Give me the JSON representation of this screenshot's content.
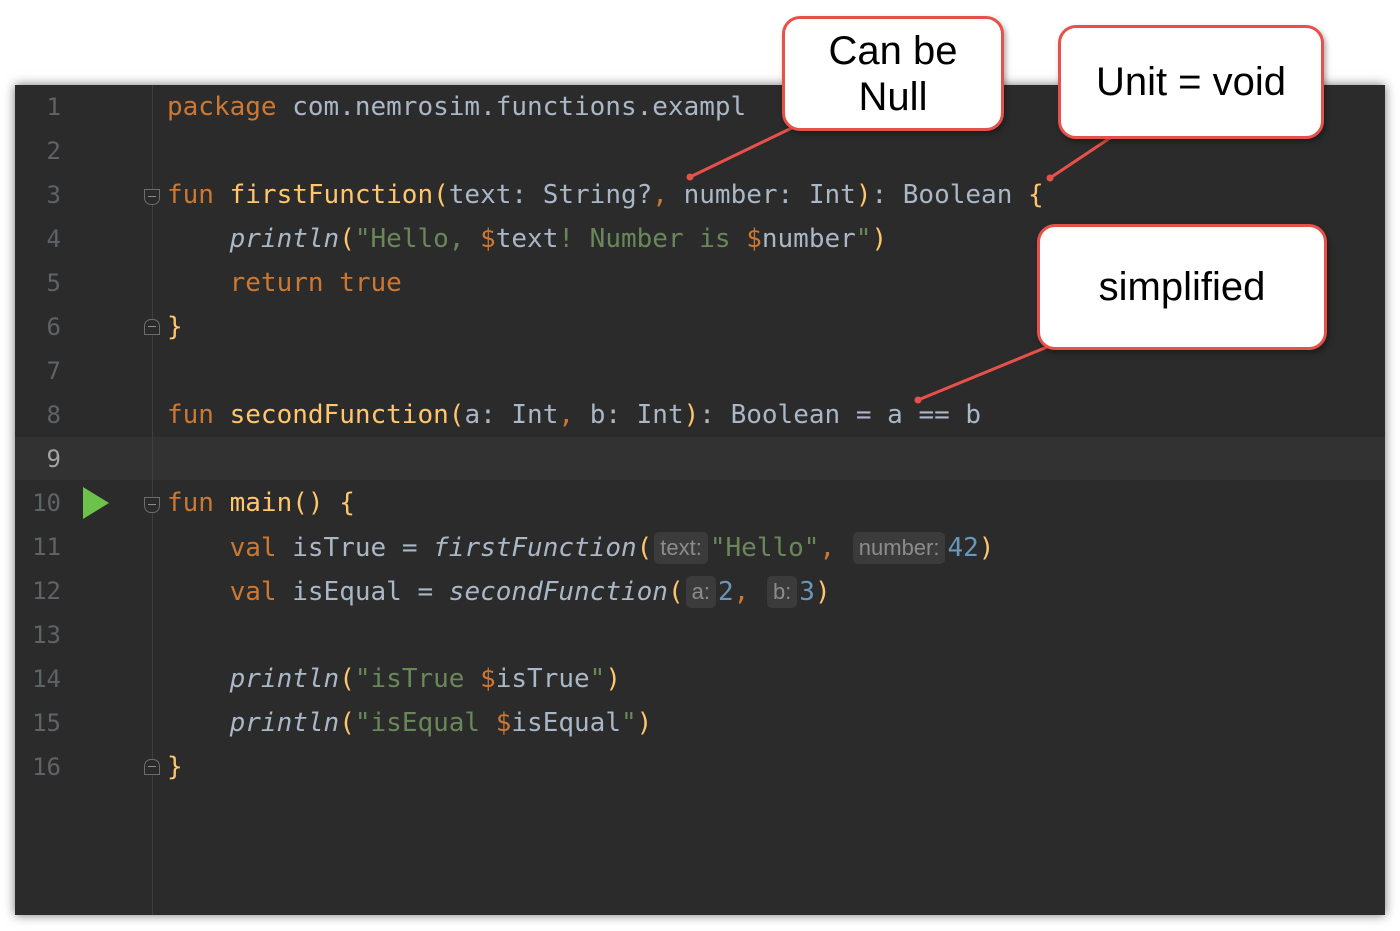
{
  "editor": {
    "lines": [
      {
        "num": "1"
      },
      {
        "num": "2"
      },
      {
        "num": "3"
      },
      {
        "num": "4"
      },
      {
        "num": "5"
      },
      {
        "num": "6"
      },
      {
        "num": "7"
      },
      {
        "num": "8"
      },
      {
        "num": "9"
      },
      {
        "num": "10"
      },
      {
        "num": "11"
      },
      {
        "num": "12"
      },
      {
        "num": "13"
      },
      {
        "num": "14"
      },
      {
        "num": "15"
      },
      {
        "num": "16"
      }
    ],
    "tokens": {
      "package_kw": "package",
      "package_name": " com.nemrosim.functions.exampl",
      "fun": "fun",
      "first_fn_name": "firstFunction",
      "text_param": "text",
      "colon": ": ",
      "string_type": "String?",
      "comma": ", ",
      "number_param": "number",
      "int_type": "Int",
      "boolean_type": "Boolean",
      "lbrace": "{",
      "rbrace": "}",
      "println": "println",
      "str_hello_open": "\"Hello, ",
      "tmpl_text": "$",
      "tmpl_text_var": "text",
      "str_number_is": "! Number is ",
      "tmpl_number": "$",
      "tmpl_number_var": "number",
      "str_quote": "\"",
      "return_kw": "return",
      "true_kw": "true",
      "second_fn_name": "secondFunction",
      "param_a": "a",
      "param_b": "b",
      "expr": " = a == b",
      "main_fn": "main",
      "empty_parens": "()",
      "val_kw": "val",
      "is_true_var": "isTrue",
      "is_equal_var": "isEqual",
      "assign": " = ",
      "lparen": "(",
      "rparen": ")",
      "hint_text": "text:",
      "str_hello": "\"Hello\"",
      "hint_number": "number:",
      "num_42": "42",
      "hint_a": "a:",
      "num_2": "2",
      "hint_b": "b:",
      "num_3": "3",
      "str_is_true_open": "\"isTrue ",
      "str_is_equal_open": "\"isEqual ",
      "dollar": "$"
    }
  },
  "callouts": {
    "nullable": "Can be Null",
    "unit": "Unit = void",
    "simplified": "simplified"
  },
  "colors": {
    "background": "#2b2b2b",
    "keyword": "#cc7832",
    "function": "#ffc66d",
    "string": "#6a8759",
    "number": "#6897bb",
    "text": "#a9b7c6",
    "callout_border": "#e8514a",
    "run_icon": "#6cc24a"
  },
  "icons": [
    "run-gutter-icon",
    "fold-marker-icon"
  ]
}
